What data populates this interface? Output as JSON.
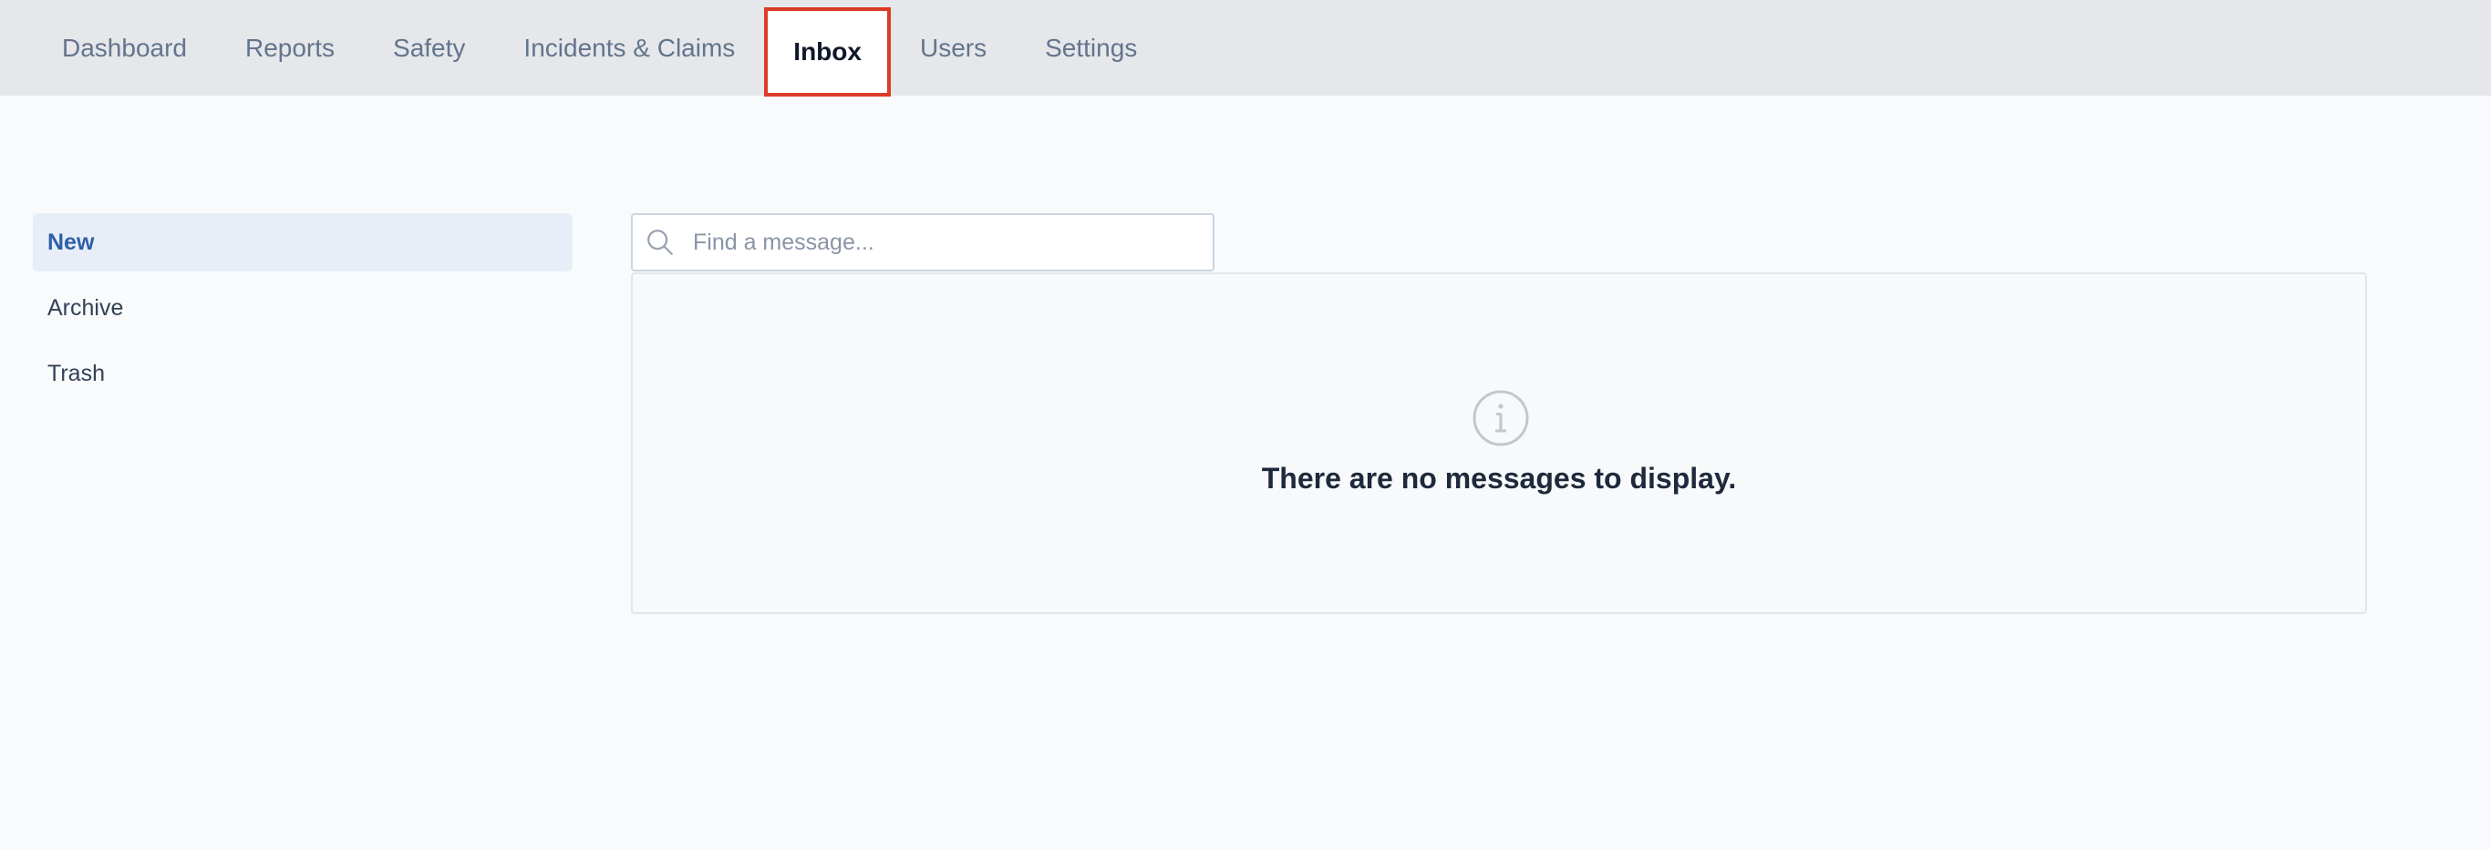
{
  "nav": {
    "tabs": [
      {
        "label": "Dashboard"
      },
      {
        "label": "Reports"
      },
      {
        "label": "Safety"
      },
      {
        "label": "Incidents & Claims"
      },
      {
        "label": "Inbox"
      },
      {
        "label": "Users"
      },
      {
        "label": "Settings"
      }
    ],
    "active": "Inbox"
  },
  "sidebar": {
    "items": [
      {
        "label": "New"
      },
      {
        "label": "Archive"
      },
      {
        "label": "Trash"
      }
    ],
    "active": "New"
  },
  "search": {
    "placeholder": "Find a message...",
    "value": "",
    "icon": "search-icon"
  },
  "messages": {
    "empty_icon": "info-icon",
    "empty_text": "There are no messages to display."
  },
  "colors": {
    "nav_bg": "#e5e7eb",
    "active_tab_outline": "#dc3b26",
    "sidebar_active_bg": "#e8eef7",
    "sidebar_active_text": "#2c5fa8"
  }
}
